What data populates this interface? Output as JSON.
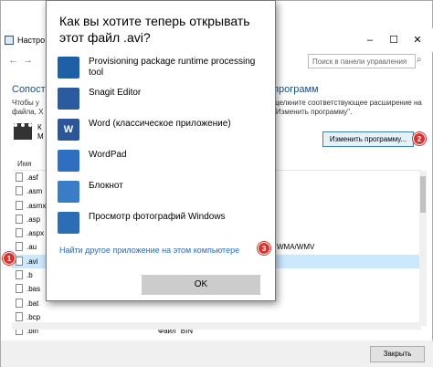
{
  "window": {
    "title": "Настро",
    "search_placeholder": "Поиск в панели управления",
    "heading_left": "Сопост",
    "heading_right": "программ",
    "desc_left": "Чтобы у файла, Х",
    "desc_right": "щелкните соответствующее расширение на \"Изменить программу\".",
    "file_icon_label": "К М",
    "change_button": "Изменить программу...",
    "column_name": "Имя",
    "close_button": "Закрыть"
  },
  "file_rows": [
    {
      "ext": ".asf",
      "desc": "",
      "desc_right": ""
    },
    {
      "ext": ".asm",
      "desc": "",
      "desc_right": ""
    },
    {
      "ext": ".asmx",
      "desc": "",
      "desc_right": ""
    },
    {
      "ext": ".asp",
      "desc": "",
      "desc_right": ""
    },
    {
      "ext": ".aspx",
      "desc": "",
      "desc_right": ""
    },
    {
      "ext": ".au",
      "desc": "",
      "desc_right": "WMA/WMV"
    },
    {
      "ext": ".avi",
      "desc": "",
      "desc_right": ""
    },
    {
      "ext": ".b",
      "desc": "",
      "desc_right": ""
    },
    {
      "ext": ".bas",
      "desc": "",
      "desc_right": ""
    },
    {
      "ext": ".bat",
      "desc": "",
      "desc_right": ""
    },
    {
      "ext": ".bcp",
      "desc": "",
      "desc_right": ""
    },
    {
      "ext": ".bin",
      "desc": "Файл \"BIN\"",
      "desc_right": ""
    }
  ],
  "dialog": {
    "title": "Как вы хотите теперь открывать этот файл .avi?",
    "apps": [
      {
        "label": "Provisioning package runtime processing tool",
        "icon": "package-icon",
        "color": "#1f5fa8"
      },
      {
        "label": "Snagit Editor",
        "icon": "snagit-icon",
        "color": "#2b5aa0"
      },
      {
        "label": "Word (классическое приложение)",
        "icon": "word-icon",
        "color": "#2b579a"
      },
      {
        "label": "WordPad",
        "icon": "wordpad-icon",
        "color": "#2f6fc1"
      },
      {
        "label": "Блокнот",
        "icon": "notepad-icon",
        "color": "#3a7cc5"
      },
      {
        "label": "Просмотр фотографий Windows",
        "icon": "photo-viewer-icon",
        "color": "#2d6db5"
      }
    ],
    "other_app_link": "Найти другое приложение на этом компьютере",
    "ok_button": "OK"
  },
  "badges": {
    "one": "1",
    "two": "2",
    "three": "3"
  }
}
